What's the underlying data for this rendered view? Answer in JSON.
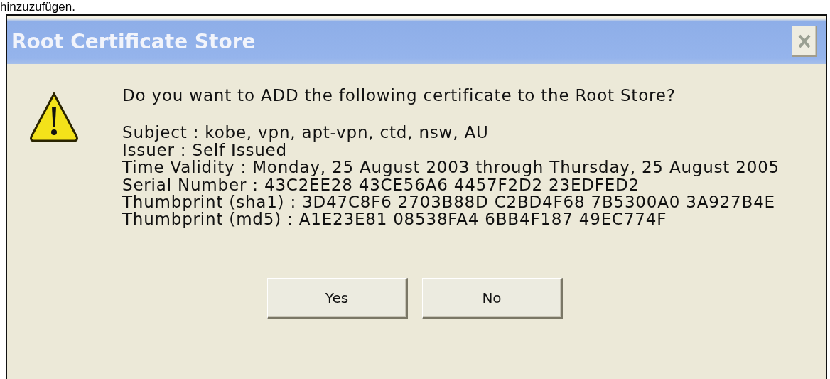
{
  "caption": "hinzuzufügen.",
  "window": {
    "title": "Root Certificate Store"
  },
  "message": {
    "question": "Do you want to ADD the following certificate to the Root Store?",
    "details": [
      "Subject : kobe, vpn, apt-vpn, ctd, nsw, AU",
      "Issuer : Self Issued",
      "Time Validity : Monday, 25 August 2003 through Thursday, 25 August 2005",
      "Serial Number : 43C2EE28 43CE56A6 4457F2D2 23EDFED2",
      "Thumbprint (sha1) : 3D47C8F6 2703B88D C2BD4F68 7B5300A0 3A927B4E",
      "Thumbprint (md5) : A1E23E81 08538FA4 6BB4F187 49EC774F"
    ]
  },
  "buttons": [
    "Yes",
    "No"
  ]
}
